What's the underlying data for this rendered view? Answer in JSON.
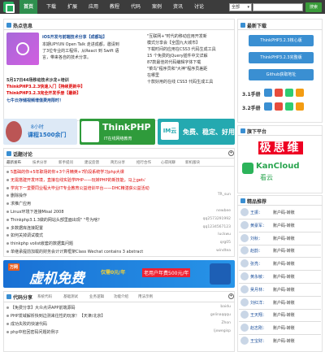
{
  "nav": {
    "items": [
      "首页",
      "下载",
      "扩展",
      "应用",
      "教程",
      "代码",
      "案例",
      "资讯",
      "讨论"
    ],
    "active_index": 0,
    "select_value": "全部",
    "search_placeholder": "",
    "search_button": "搜索"
  },
  "hot": {
    "title": "热点信息",
    "feature_title": "iOS开发与前端技术分享【成都站】",
    "feature_lines": [
      "本期UPYUN Open Talk 走进成都，邀请到",
      "了3位专业的工程师，从React 到 Swift 语",
      "言，带来各自的技术分享。"
    ],
    "right_lines": [
      "\"互联网+\"时代的移动应用开发新",
      "模式分享会【全国九大城市】",
      "下载时间的应用在CSS3 代码生成工具",
      "15 个免费的jQuery插件中文详解",
      "87款最佳的代码编辑字体下载",
      "\"菜鸟\"程序员和\"大神\"程序员差距",
      "在哪里",
      "十款好用的在线 CSS3 代码生成工具"
    ],
    "news": [
      "5月17日44场移动技术沙龙+培训",
      "ThinkPHP3.2.3快速入门【持续更新中】",
      "ThinkPHP3.2.3完全开发手册【最新】",
      "七牛云存储视频增值费用限时！"
    ]
  },
  "ads": {
    "course_online": "8小时",
    "course_count": "课程1500余门",
    "thinkphp_brand": "ThinkPHP",
    "thinkphp_sub": "IT在线网络教育",
    "free_text": "免费、稳定、好用",
    "free_brand": "IM云"
  },
  "latest": {
    "title": "最新下载",
    "buttons": [
      "ThinkPHP3.2.3核心版",
      "ThinkPHP3.2.3完整版",
      "Github获取地址"
    ],
    "versions": [
      {
        "label": "3.1手册"
      },
      {
        "label": "3.2手册"
      }
    ]
  },
  "sponsor": {
    "title": "旗下平台",
    "brand_a": "极思维",
    "brand_b": "KanCloud",
    "brand_b_sub": "看云"
  },
  "topics": {
    "title": "话题讨论",
    "tabs": [
      "最新发布",
      "技术分享",
      "新手提问",
      "建议反馈",
      "简历分享",
      "招行合作",
      "心得闲聊",
      "新机版块"
    ],
    "rows": [
      {
        "title": "5基础的你+5年职场的你+3个月精英+7阶段系统学习php大课",
        "user": "",
        "red": true
      },
      {
        "title": "无需搭建开发环境，直接在线实验学PHP——玩转PHP的新技能，马上get√",
        "user": "",
        "red": true
      },
      {
        "title": "学完下一堂要同业程大毕业IT专业教育公益培训平台——DHC精湛获公益活动",
        "user": "",
        "red": true
      },
      {
        "title": "删除操作",
        "user": "TR_sun",
        "red": false
      },
      {
        "title": "求推广应用",
        "user": "",
        "red": false
      },
      {
        "title": "Linux环境下连接Misal 2008",
        "user": "newbee",
        "red": false
      },
      {
        "title": "Thinkphp3.1.3做的网站头部里面出现\" \"号为啥？",
        "user": "qq2573291992",
        "red": false
      },
      {
        "title": "多数据库连接配置",
        "user": "qq1234567123",
        "red": false
      },
      {
        "title": "如何关掉调试模式",
        "user": "luckwu",
        "red": false
      },
      {
        "title": "thinkphp volist嵌套的数据集问题",
        "user": "qrg05",
        "red": false
      },
      {
        "title": "单继承提前加载的财务会计计算框架Class Wechat contains 3 abstract",
        "user": "windtea",
        "red": false
      }
    ]
  },
  "banner": {
    "brand": "万网",
    "headline": "虚机免费",
    "sub_a": "仅需0元/年",
    "sub_b": "老用户年费500元/年"
  },
  "code": {
    "title": "代码分享",
    "tabs": [
      "系统代码",
      "基础测试",
      "业务逻辑",
      "功能介绍",
      "用法示例"
    ],
    "rows": [
      {
        "title": "【免费分享】大众点评APP前端源码",
        "user": "baidu"
      },
      {
        "title": "PHP发域解析快到边测来往性的玩家！【天津/北京】",
        "user": "gelinaqqqu"
      },
      {
        "title": "成功失败的快速代码",
        "user": "Zhon"
      },
      {
        "title": "php中检回密码问题的例子",
        "user": "ljxwegisp"
      }
    ]
  },
  "contrib": {
    "title": "精品推荐",
    "rows": [
      {
        "name": "王振：",
        "text": "账户码-转账"
      },
      {
        "name": "黄豪军：",
        "text": "账户码-转账"
      },
      {
        "name": "刘秋：",
        "text": "账户码-转账"
      },
      {
        "name": "赵韵：",
        "text": "账户码-转账"
      },
      {
        "name": "张亮：",
        "text": "账户码-转账"
      },
      {
        "name": "黄永敏：",
        "text": "账户码-转账"
      },
      {
        "name": "吴月林：",
        "text": "账户码-转账"
      },
      {
        "name": "刘红洋：",
        "text": "账户码-转账"
      },
      {
        "name": "王天翔：",
        "text": "账户码-转账"
      },
      {
        "name": "赵志刚：",
        "text": "账户码-转账"
      },
      {
        "name": "王宝财：",
        "text": "账户码-转账"
      }
    ]
  },
  "colors": {
    "topbar": "#3c3c3c",
    "active": "#2f8f4e",
    "accent": "#3a8fd2",
    "green": "#3a9b3a",
    "red": "#dd0000",
    "banner": "#1f7fd6",
    "banner_yellow": "#f7d232"
  }
}
